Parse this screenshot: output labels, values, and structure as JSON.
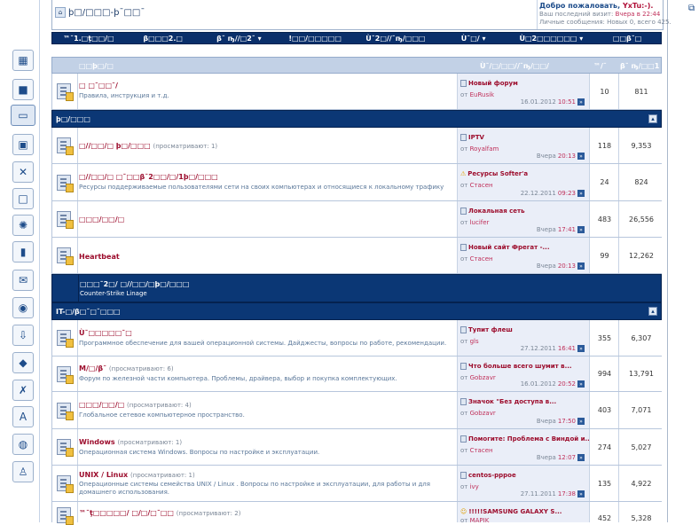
{
  "header": {
    "logo_text": "þ□/□□□-þ¯□□¯",
    "welcome_prefix": "Добро пожаловать,",
    "username": "YxTu:-).",
    "last_visit_label": "Ваш последний визит:",
    "last_visit_value": "Вчера в 22:44",
    "messages_label": "Личные сообщения:",
    "messages_value": "Новых 0, всего 425."
  },
  "nav": [
    {
      "label": "™¯1.□ţ□□/□"
    },
    {
      "label": "β□□□2.□"
    },
    {
      "label": "β¯ ҧ//□2¯ ▾"
    },
    {
      "label": "!□□/□□□□□"
    },
    {
      "label": "Ù¯2□//¯ҧ/□□□"
    },
    {
      "label": "Ù¯□/ ▾"
    },
    {
      "label": "Ù□2□□□□□□ ▾"
    },
    {
      "label": "□□β¯□"
    }
  ],
  "columns": {
    "forum": "□□þ□/□",
    "last_post": "Ù¯/□/□□//¯ҧ/□□/",
    "topics": "™/¯",
    "posts": "β¯ ҧ/□□1"
  },
  "categories": [
    {
      "title": "þ□/□□□"
    },
    {
      "title": "□□□¯2□/ □//□□/□þ□/□□□",
      "description": "Counter-Strike Linage"
    },
    {
      "title": "IT-□/β□¯□¯□□□"
    }
  ],
  "forums": [
    {
      "title": "□ □¯□□¯/",
      "viewing": "",
      "description": "Правила, инструкция и т.д.",
      "last_title": "Новый форум",
      "last_author": "EuRusik",
      "last_date": "16.01.2012",
      "last_time": "10:51",
      "topics": "10",
      "posts": "811"
    },
    {
      "title": "□//□□/□ þ□/□□□",
      "viewing": "(просматривают: 1)",
      "description": "",
      "last_title": "IPTV",
      "last_author": "Royalfam",
      "last_date": "Вчера",
      "last_time": "20:13",
      "topics": "118",
      "posts": "9,353"
    },
    {
      "title": "□//□□/□ □¯□□β¯2□□/□/1þ□/□□□",
      "viewing": "",
      "description": "Ресурсы поддерживаемые пользователями сети на своих компьютерах и относящиеся к локальному трафику",
      "last_title": "Ресурсы Softer'a",
      "last_author": "Стасен",
      "last_date": "22.12.2011",
      "last_time": "09:23",
      "topics": "24",
      "posts": "824"
    },
    {
      "title": "□□□/□□/□",
      "viewing": "",
      "description": "",
      "last_title": "Локальная сеть",
      "last_author": "lucifer",
      "last_date": "Вчера",
      "last_time": "17:41",
      "topics": "483",
      "posts": "26,556"
    },
    {
      "title": "Heartbeat",
      "viewing": "",
      "description": "",
      "last_title": "Новый сайт Фрегат -...",
      "last_author": "Стасен",
      "last_date": "Вчера",
      "last_time": "20:13",
      "topics": "99",
      "posts": "12,262"
    },
    {
      "title": "Ù¯□□□□□¯□",
      "viewing": "",
      "description": "Программное обеспечение для вашей операционной системы. Дайджесты, вопросы по работе, рекомендации.",
      "last_title": "Тупит флеш",
      "last_author": "gls",
      "last_date": "27.12.2011",
      "last_time": "16:41",
      "topics": "355",
      "posts": "6,307"
    },
    {
      "title": "M/□/β¯",
      "viewing": "(просматривают: 6)",
      "description": "Форум по железной части компьютера. Проблемы, драйвера, выбор и покупка комплектующих.",
      "last_title": "Что больше всего шумит в...",
      "last_author": "Gobzavr",
      "last_date": "16.01.2012",
      "last_time": "20:52",
      "topics": "994",
      "posts": "13,791"
    },
    {
      "title": "□□□/□□/□",
      "viewing": "(просматривают: 4)",
      "description": "Глобальное сетевое компьютерное пространство.",
      "last_title": "Значок \"Без доступа в...",
      "last_author": "Gobzavr",
      "last_date": "Вчера",
      "last_time": "17:50",
      "topics": "403",
      "posts": "7,071"
    },
    {
      "title": "Windows",
      "viewing": "(просматривают: 1)",
      "description": "Операционная система Windows. Вопросы по настройке и эксплуатации.",
      "last_title": "Помогите: Проблема с Виндой и...",
      "last_author": "Стасен",
      "last_date": "Вчера",
      "last_time": "12:07",
      "topics": "274",
      "posts": "5,027"
    },
    {
      "title": "UNIX / Linux",
      "viewing": "(просматривают: 1)",
      "description": "Операционные системы семейства UNIX / Linux . Вопросы по настройке и эксплуатации, для работы и для домашнего использования.",
      "last_title": "centos-pppoe",
      "last_author": "ivy",
      "last_date": "27.11.2011",
      "last_time": "17:38",
      "topics": "135",
      "posts": "4,922"
    },
    {
      "title": "™¯ţ□□□□□/ □/□/□¯□□",
      "viewing": "(просматривают: 2)",
      "description": "",
      "last_title": "!!!!!SAMSUNG GALAXY S...",
      "last_author": "MAPIK",
      "last_date": "",
      "last_time": "",
      "topics": "452",
      "posts": "5,328"
    }
  ],
  "sidebar_icons": [
    {
      "name": "grid-icon",
      "glyph": "▦"
    },
    {
      "name": "camera-icon",
      "glyph": "■"
    },
    {
      "name": "monitor-icon",
      "glyph": "▭"
    },
    {
      "name": "tv-icon",
      "glyph": "▣"
    },
    {
      "name": "satellite-icon",
      "glyph": "✕"
    },
    {
      "name": "screen-icon",
      "glyph": "□"
    },
    {
      "name": "film-reel-icon",
      "glyph": "✺"
    },
    {
      "name": "flag-icon",
      "glyph": "▮"
    },
    {
      "name": "chat-bubble-icon",
      "glyph": "✉"
    },
    {
      "name": "photo-camera-icon",
      "glyph": "◉"
    },
    {
      "name": "download-icon",
      "glyph": "⇩"
    },
    {
      "name": "diamond-icon",
      "glyph": "◆"
    },
    {
      "name": "runner-icon",
      "glyph": "✗"
    },
    {
      "name": "text-tool-icon",
      "glyph": "A"
    },
    {
      "name": "location-pin-icon",
      "glyph": "◍"
    },
    {
      "name": "figure-icon",
      "glyph": "♙"
    }
  ]
}
